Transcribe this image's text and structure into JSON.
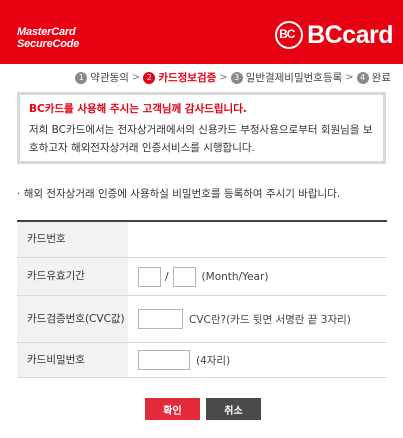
{
  "header": {
    "mastercard_line1": "MasterCard",
    "mastercard_line2": "SecureCode",
    "bc_mark": "BC",
    "bc_brand": "BCcard",
    "brand_color": "#e60012"
  },
  "steps": [
    {
      "num": "1",
      "label": "약관동의",
      "active": false
    },
    {
      "num": "2",
      "label": "카드정보검증",
      "active": true
    },
    {
      "num": "3",
      "label": "일반결제비밀번호등록",
      "active": false
    },
    {
      "num": "4",
      "label": "완료",
      "active": false
    }
  ],
  "notice": {
    "title": "BC카드를 사용해 주시는 고객님께 감사드립니다.",
    "body": "저희 BC카드에서는 전자상거래에서의 신용카드 부정사용으로부터 회원님을 보호하고자 해외전자상거래 인증서비스를 시행합니다."
  },
  "instruction": "해외 전자상거래 인증에 사용하실 비밀번호를 등록하여 주시기 바랍니다.",
  "form": {
    "card_number": {
      "label": "카드번호"
    },
    "expiry": {
      "label": "카드유효기간",
      "separator": "/",
      "hint": "(Month/Year)",
      "month_value": "",
      "year_value": ""
    },
    "cvc": {
      "label": "카드검증번호(CVC값)",
      "hint": "CVC란?(카드 뒷면 서명란 끝 3자리)",
      "value": ""
    },
    "password": {
      "label": "카드비밀번호",
      "hint": "(4자리)",
      "value": ""
    }
  },
  "buttons": {
    "confirm": "확인",
    "cancel": "취소"
  }
}
